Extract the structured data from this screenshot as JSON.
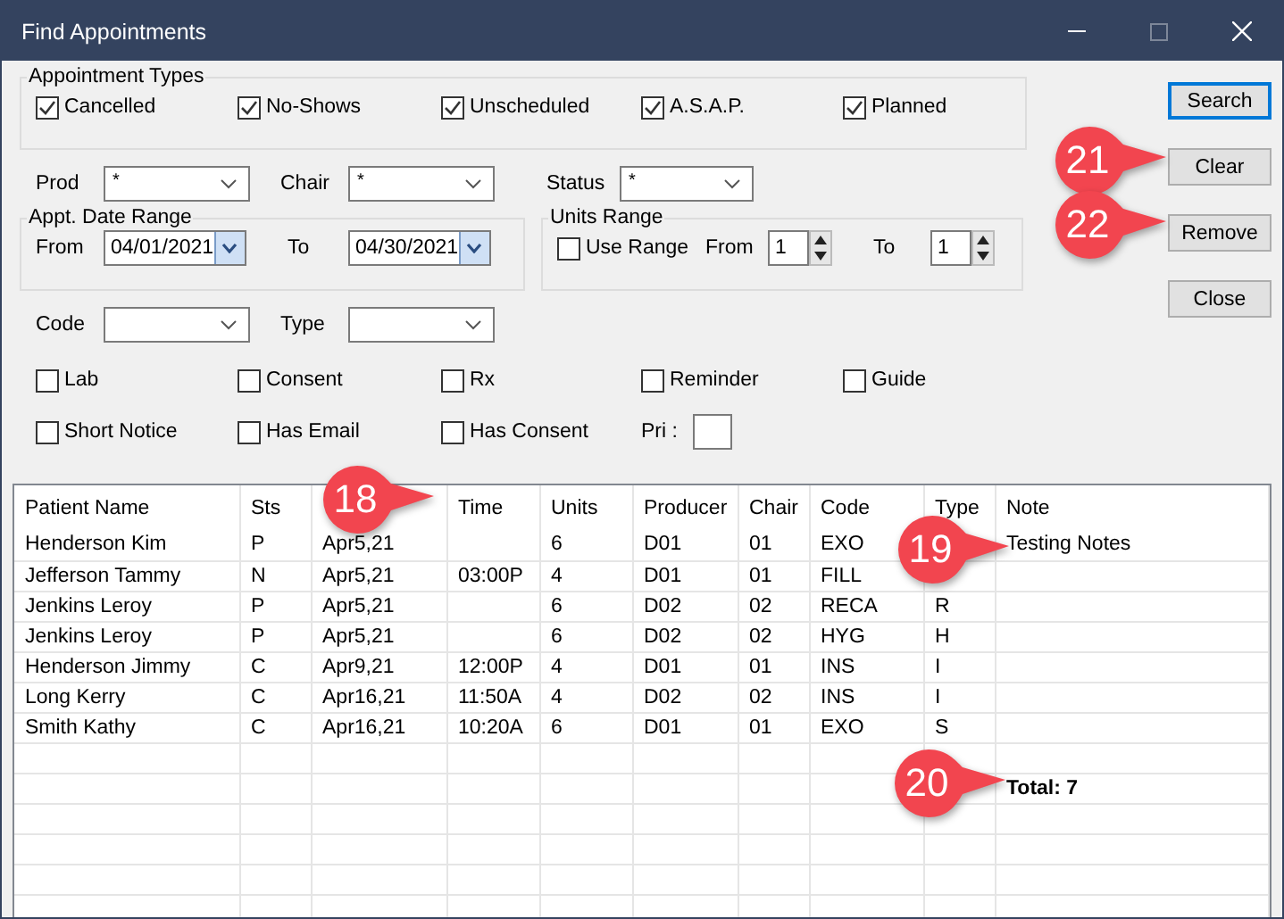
{
  "window": {
    "title": "Find Appointments"
  },
  "appointment_types": {
    "label": "Appointment Types",
    "items": [
      {
        "label": "Cancelled",
        "checked": true
      },
      {
        "label": "No-Shows",
        "checked": true
      },
      {
        "label": "Unscheduled",
        "checked": true
      },
      {
        "label": "A.S.A.P.",
        "checked": true
      },
      {
        "label": "Planned",
        "checked": true
      }
    ]
  },
  "filters": [
    {
      "label": "Prod",
      "value": "*"
    },
    {
      "label": "Chair",
      "value": "*"
    },
    {
      "label": "Status",
      "value": "*"
    }
  ],
  "date_range": {
    "label": "Appt. Date Range",
    "from_label": "From",
    "from": "04/01/2021",
    "to_label": "To",
    "to": "04/30/2021"
  },
  "units_range": {
    "label": "Units Range",
    "use_range": {
      "label": "Use Range",
      "checked": false
    },
    "from_label": "From",
    "from": "1",
    "to_label": "To",
    "to": "1"
  },
  "code_filters": [
    {
      "label": "Code"
    },
    {
      "label": "Type"
    }
  ],
  "options": [
    {
      "label": "Lab",
      "checked": false
    },
    {
      "label": "Consent",
      "checked": false
    },
    {
      "label": "Rx",
      "checked": false
    },
    {
      "label": "Reminder",
      "checked": false
    },
    {
      "label": "Guide",
      "checked": false
    }
  ],
  "options_row2": [
    {
      "label": "Short Notice",
      "checked": false
    },
    {
      "label": "Has Email",
      "checked": false
    },
    {
      "label": "Has Consent",
      "checked": false
    }
  ],
  "priority": {
    "label": "Pri :"
  },
  "buttons": [
    {
      "label": "Search",
      "focused": true
    },
    {
      "label": "Clear",
      "focused": false
    },
    {
      "label": "Remove",
      "focused": false
    },
    {
      "label": "Close",
      "focused": false
    }
  ],
  "table": {
    "columns": [
      {
        "label": "Patient Name"
      },
      {
        "label": "Sts"
      },
      {},
      {
        "label": "Time"
      },
      {
        "label": "Units"
      },
      {
        "label": "Producer"
      },
      {
        "label": "Chair"
      },
      {
        "label": "Code"
      },
      {
        "label": "Type"
      },
      {
        "label": "Note"
      }
    ],
    "rows": [
      [
        "Henderson Kim",
        "P",
        "Apr5,21",
        null,
        "6",
        "D01",
        "01",
        "EXO",
        null,
        "Testing Notes"
      ],
      [
        "Jefferson Tammy",
        "N",
        "Apr5,21",
        "03:00P",
        "4",
        "D01",
        "01",
        "FILL",
        null,
        null
      ],
      [
        "Jenkins Leroy",
        "P",
        "Apr5,21",
        null,
        "6",
        "D02",
        "02",
        "RECA",
        "R",
        null
      ],
      [
        "Jenkins Leroy",
        "P",
        "Apr5,21",
        null,
        "6",
        "D02",
        "02",
        "HYG",
        "H",
        null
      ],
      [
        "Henderson Jimmy",
        "C",
        "Apr9,21",
        "12:00P",
        "4",
        "D01",
        "01",
        "INS",
        "I",
        null
      ],
      [
        "Long Kerry",
        "C",
        "Apr16,21",
        "11:50A",
        "4",
        "D02",
        "02",
        "INS",
        "I",
        null
      ],
      [
        "Smith Kathy",
        "C",
        "Apr16,21",
        "10:20A",
        "6",
        "D01",
        "01",
        "EXO",
        "S",
        null
      ]
    ],
    "total": "Total: 7"
  },
  "callouts": [
    {
      "number": "18"
    },
    {
      "number": "19"
    },
    {
      "number": "20"
    },
    {
      "number": "21"
    },
    {
      "number": "22"
    }
  ]
}
